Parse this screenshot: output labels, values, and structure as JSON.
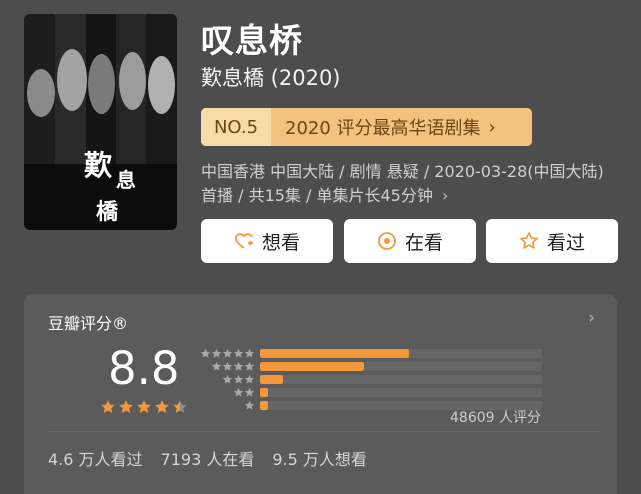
{
  "movie": {
    "title": "叹息桥",
    "subtitle": "歎息橋 (2020)",
    "rank": {
      "no": "NO.5",
      "text": "2020 评分最高华语剧集",
      "chevron": "›"
    },
    "meta": "中国香港 中国大陆 / 剧情 悬疑 / 2020-03-28(中国大陆) 首播 / 共15集 / 单集片长45分钟",
    "meta_chevron": "›",
    "poster_text": "歎息橋"
  },
  "actions": [
    {
      "label": "想看",
      "icon": "heart-plus-icon"
    },
    {
      "label": "在看",
      "icon": "target-circle-icon"
    },
    {
      "label": "看过",
      "icon": "star-outline-icon"
    }
  ],
  "rating": {
    "title": "豆瓣评分®",
    "chevron": "›",
    "score": "8.8",
    "stars": 4.5,
    "distribution": [
      {
        "stars": 5,
        "fraction": 0.53
      },
      {
        "stars": 4,
        "fraction": 0.37
      },
      {
        "stars": 3,
        "fraction": 0.08
      },
      {
        "stars": 2,
        "fraction": 0.02
      },
      {
        "stars": 1,
        "fraction": 0.02
      }
    ],
    "count_text": "48609 人评分",
    "stats": [
      "4.6 万人看过",
      "7193 人在看",
      "9.5 万人想看"
    ]
  },
  "colors": {
    "background": "#4d4d4d",
    "panel": "#5b5b5b",
    "accent": "#f4993a",
    "rank_bg": "#f2c27e"
  }
}
